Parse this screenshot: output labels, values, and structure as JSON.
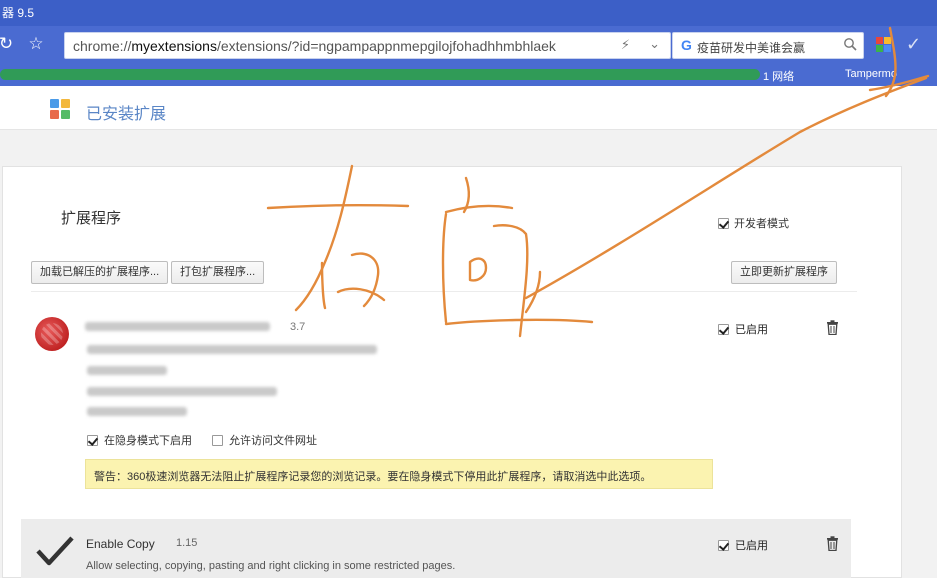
{
  "window": {
    "title": "器 9.5"
  },
  "toolbar": {
    "url_prefix": "chrome://",
    "url_host": "myextensions",
    "url_rest": "/extensions/?id=ngpampappnmepgilojfohadhhmbhlaek",
    "search_query": "疫苗研发中美谁会赢"
  },
  "bookmarks": {
    "items": [
      "1 网络",
      "Tampermo"
    ]
  },
  "page": {
    "title": "已安装扩展"
  },
  "extensions_panel": {
    "section_title": "扩展程序",
    "developer_mode_label": "开发者模式",
    "developer_mode_checked": true,
    "load_unpacked_button": "加载已解压的扩展程序...",
    "pack_button": "打包扩展程序...",
    "update_button": "立即更新扩展程序"
  },
  "extension1": {
    "version": "3.7",
    "enabled_label": "已启用",
    "enabled": true,
    "incognito_label": "在隐身模式下启用",
    "incognito_checked": true,
    "file_access_label": "允许访问文件网址",
    "file_access_checked": false,
    "warning": "警告：360极速浏览器无法阻止扩展程序记录您的浏览记录。要在隐身模式下停用此扩展程序，请取消选中此选项。"
  },
  "extension2": {
    "name": "Enable Copy",
    "version": "1.15",
    "description": "Allow selecting, copying, pasting and right clicking in some restricted pages.",
    "enabled_label": "已启用",
    "enabled": true
  },
  "colors": {
    "toolbar": "#4a6bd1",
    "titlebar": "#3c5fc7",
    "page_title": "#5a86c6",
    "warning_bg": "#fbf3b0",
    "annotation": "#e38a3c"
  }
}
